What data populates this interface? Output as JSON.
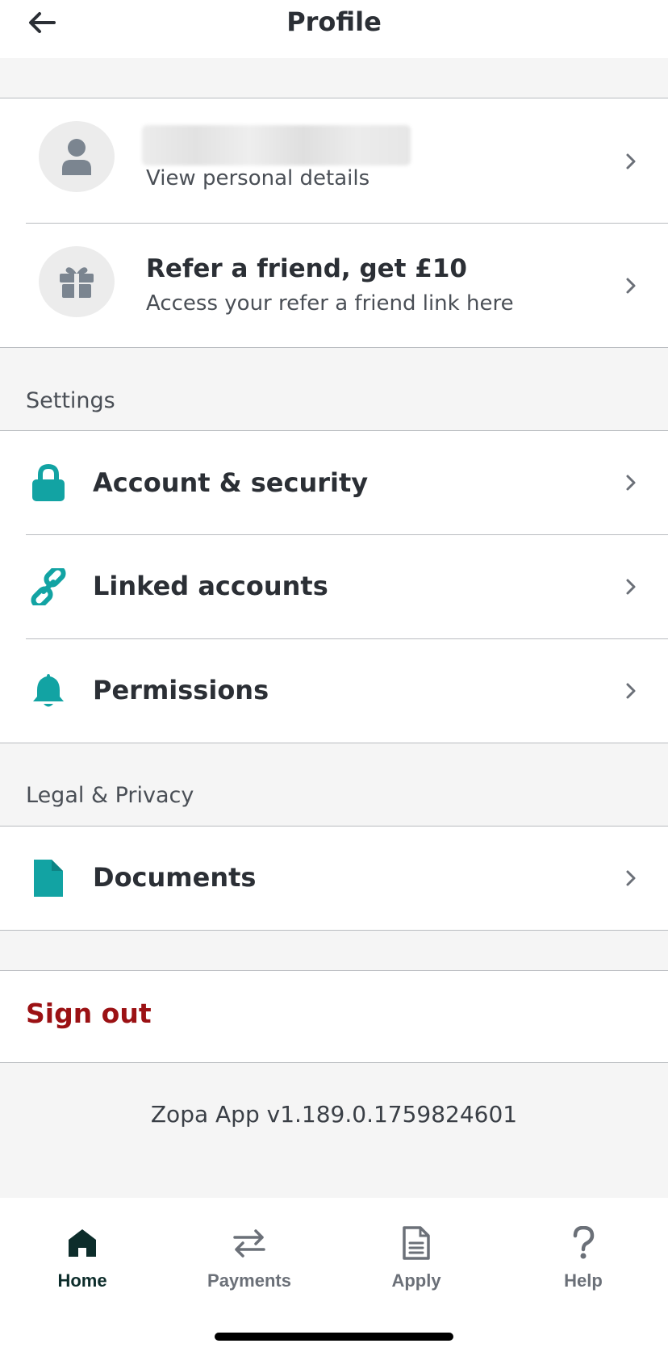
{
  "header": {
    "title": "Profile",
    "back_icon": "arrow-left-icon"
  },
  "profile": {
    "name_hidden": true,
    "subtitle": "View personal details",
    "avatar_icon": "user-icon"
  },
  "referral": {
    "title": "Refer a friend, get £10",
    "subtitle": "Access your refer a friend link here",
    "icon": "gift-icon"
  },
  "settings": {
    "section_label": "Settings",
    "items": [
      {
        "label": "Account & security",
        "icon": "lock-icon"
      },
      {
        "label": "Linked accounts",
        "icon": "link-icon"
      },
      {
        "label": "Permissions",
        "icon": "bell-icon"
      }
    ]
  },
  "legal": {
    "section_label": "Legal & Privacy",
    "items": [
      {
        "label": "Documents",
        "icon": "document-icon"
      }
    ]
  },
  "signout": {
    "label": "Sign out"
  },
  "version": {
    "text": "Zopa App v1.189.0.1759824601"
  },
  "bottom_nav": {
    "items": [
      {
        "label": "Home",
        "icon": "home-icon",
        "active": true
      },
      {
        "label": "Payments",
        "icon": "transfer-arrows-icon",
        "active": false
      },
      {
        "label": "Apply",
        "icon": "document-outline-icon",
        "active": false
      },
      {
        "label": "Help",
        "icon": "question-mark-icon",
        "active": false
      }
    ]
  },
  "colors": {
    "accent": "#12a3a3",
    "danger": "#9b1114",
    "active_nav": "#0d2d2b",
    "inactive_nav": "#6b7078",
    "background": "#f5f5f5"
  }
}
